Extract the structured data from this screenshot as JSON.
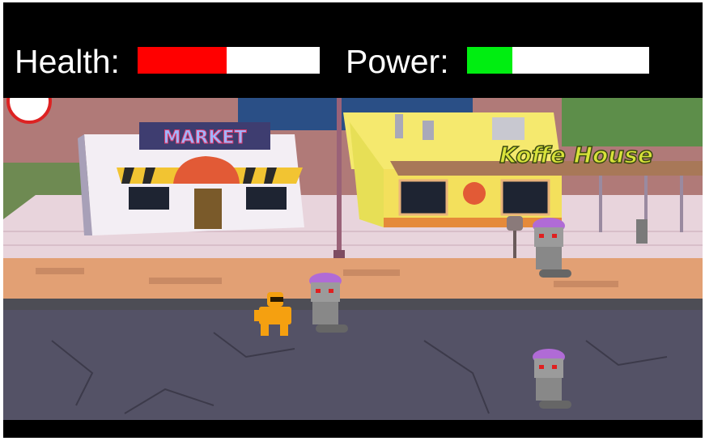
{
  "hud": {
    "health_label": "Health:",
    "health_value": 0.49,
    "health_color": "#ff0000",
    "power_label": "Power:",
    "power_value": 0.25,
    "power_color": "#00ee11"
  },
  "scene": {
    "market_sign": "MARKET",
    "cafe_sign": "Koffe House",
    "player_color": "#f5a010",
    "enemy_count": 3
  }
}
